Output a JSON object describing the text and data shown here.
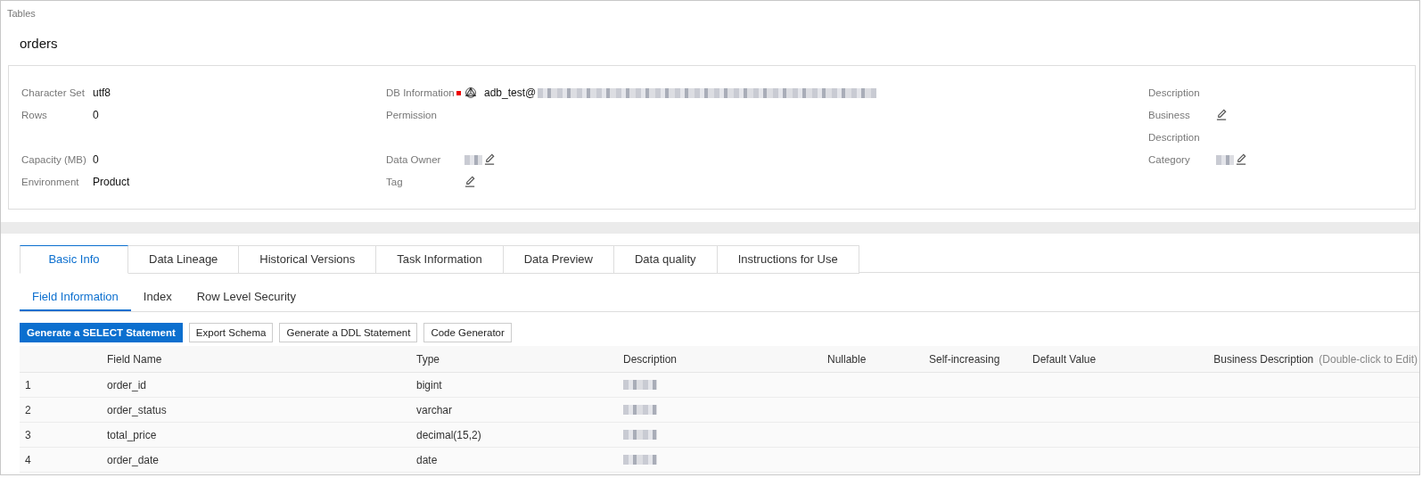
{
  "breadcrumb": "Tables",
  "title": "orders",
  "info_rows": [
    [
      {
        "label": "Character Set",
        "value": "utf8"
      },
      {
        "label": "DB Information",
        "flag": true,
        "db_icon": true,
        "value": "adb_test@",
        "redacted": true
      },
      {
        "label": "Description"
      }
    ],
    [
      {
        "label": "Rows",
        "value": "0"
      },
      {
        "label": "Permission"
      },
      {
        "label": "Business Description",
        "editable": true
      }
    ],
    [
      {
        "label": "Capacity (MB)",
        "value": "0"
      },
      {
        "label": "Data Owner",
        "redacted": true,
        "editable": true
      },
      {
        "label": "Category",
        "redacted": true,
        "editable": true
      }
    ],
    [
      {
        "label": "Environment",
        "value": "Product"
      },
      {
        "label": "Tag",
        "editable": true
      }
    ]
  ],
  "tabs": [
    {
      "label": "Basic Info",
      "selected": true
    },
    {
      "label": "Data Lineage",
      "selected": false
    },
    {
      "label": "Historical Versions",
      "selected": false
    },
    {
      "label": "Task Information",
      "selected": false
    },
    {
      "label": "Data Preview",
      "selected": false
    },
    {
      "label": "Data quality",
      "selected": false
    },
    {
      "label": "Instructions for Use",
      "selected": false
    }
  ],
  "subtabs": [
    {
      "label": "Field Information",
      "selected": true
    },
    {
      "label": "Index",
      "selected": false
    },
    {
      "label": "Row Level Security",
      "selected": false
    }
  ],
  "buttons": [
    {
      "label": "Generate a SELECT Statement",
      "kind": "primary"
    },
    {
      "label": "Export Schema",
      "kind": "default"
    },
    {
      "label": "Generate a DDL Statement",
      "kind": "default"
    },
    {
      "label": "Code Generator",
      "kind": "default"
    }
  ],
  "table": {
    "columns": [
      {
        "label": "Field Name"
      },
      {
        "label": "Type"
      },
      {
        "label": "Description"
      },
      {
        "label": "Nullable"
      },
      {
        "label": "Self-increasing"
      },
      {
        "label": "Default Value"
      },
      {
        "label": "Business Description",
        "hint": "(Double-click to Edit)"
      }
    ],
    "rows": [
      {
        "index": "1",
        "field_name": "order_id",
        "type": "bigint",
        "description_redacted": true
      },
      {
        "index": "2",
        "field_name": "order_status",
        "type": "varchar",
        "description_redacted": true
      },
      {
        "index": "3",
        "field_name": "total_price",
        "type": "decimal(15,2)",
        "description_redacted": true
      },
      {
        "index": "4",
        "field_name": "order_date",
        "type": "date",
        "description_redacted": true
      }
    ]
  }
}
